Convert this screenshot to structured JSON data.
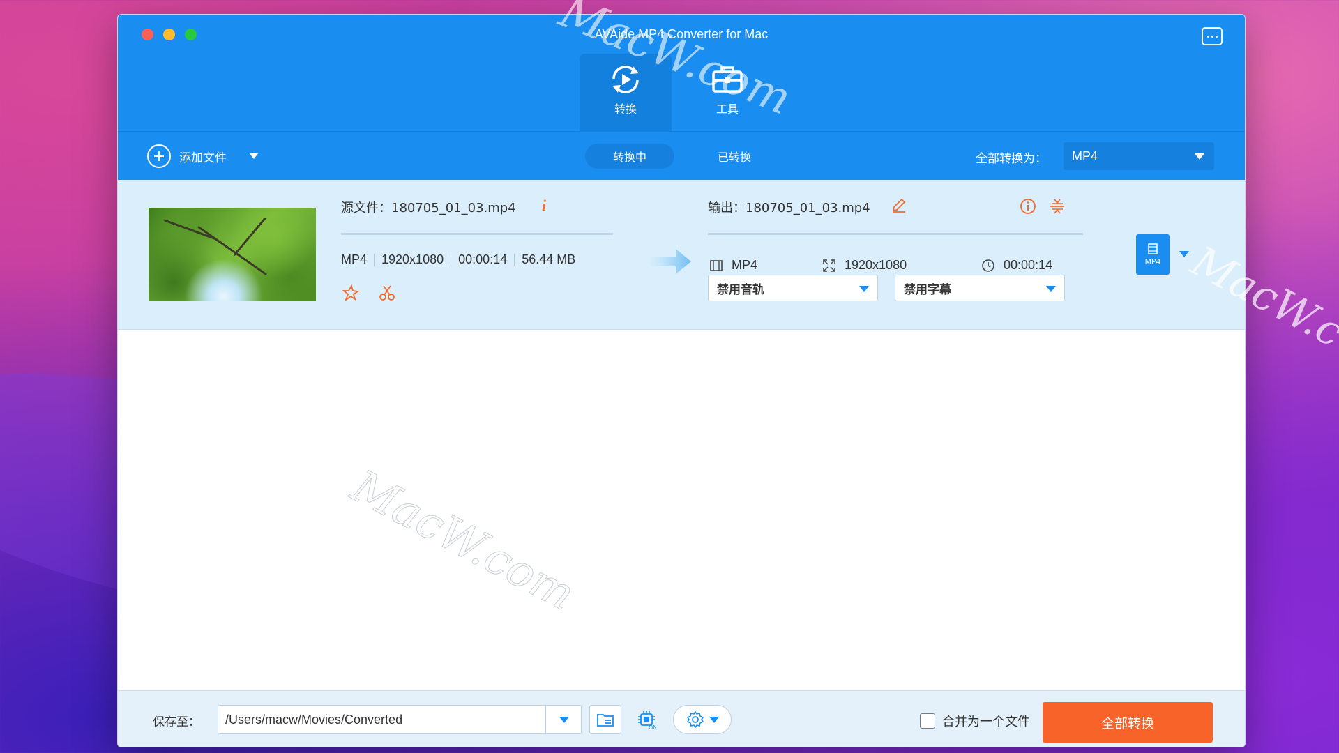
{
  "window": {
    "title": "AVAide MP4 Converter for Mac"
  },
  "modes": {
    "convert_label": "转换",
    "tools_label": "工具"
  },
  "toolbar": {
    "add_file_label": "添加文件",
    "tab_converting": "转换中",
    "tab_converted": "已转换",
    "convert_all_to_label": "全部转换为：",
    "output_format": "MP4"
  },
  "file": {
    "source_name": "源文件：180705_01_03.mp4",
    "source_format": "MP4",
    "source_resolution": "1920x1080",
    "source_duration": "00:00:14",
    "source_size": "56.44 MB",
    "output_name": "输出：180705_01_03.mp4",
    "output_format": "MP4",
    "output_resolution": "1920x1080",
    "output_duration": "00:00:14",
    "audio_track": "禁用音轨",
    "subtitle": "禁用字幕",
    "badge_format": "MP4",
    "info_glyph": "i"
  },
  "footer": {
    "save_to_label": "保存至：",
    "save_path": "/Users/macw/Movies/Converted",
    "merge_label": "合并为一个文件",
    "merge_checked": false,
    "convert_all_button": "全部转换",
    "hw_accel_badge": "ON"
  },
  "watermark": {
    "text_top": "MacW.com",
    "text_mid": "MacW.com",
    "text_right": "MacW.c"
  },
  "colors": {
    "accent": "#1a8ef0",
    "action": "#f76328",
    "row_bg": "#daeefb",
    "icon_orange": "#f26b2a"
  },
  "icons": {
    "convert_tab": "convert-cycle-icon",
    "tools_tab": "toolbox-icon",
    "chat": "chat-bubble-icon",
    "add": "plus-circle-icon",
    "enhance": "star-magic-icon",
    "cut": "scissors-icon",
    "edit_name": "pencil-icon",
    "output_info": "info-circle-icon",
    "split": "split-icon",
    "film": "film-icon",
    "resolution": "expand-icon",
    "duration": "clock-icon",
    "folder": "folder-icon",
    "hw_accel": "cpu-icon",
    "settings": "gear-icon"
  }
}
